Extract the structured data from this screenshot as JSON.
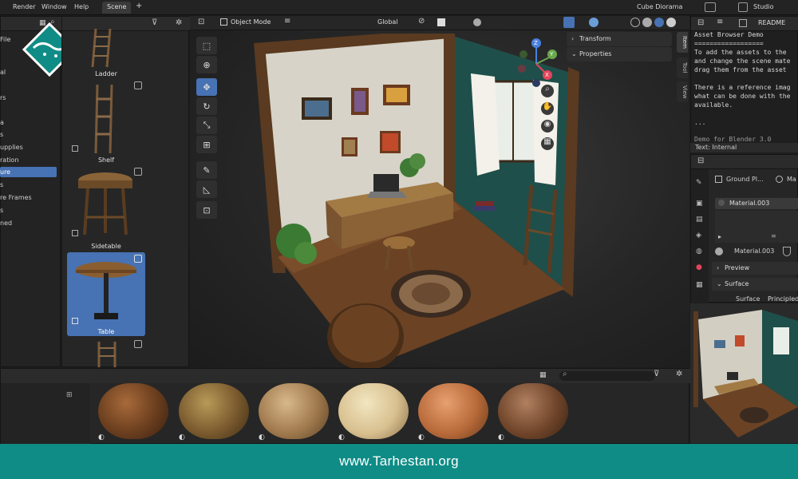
{
  "topbar": {
    "menus": [
      "Render",
      "Window",
      "Help"
    ],
    "scene_tab": "Scene",
    "plus": "+",
    "scene_name": "Cube Diorama",
    "workspace": "Studio"
  },
  "left_panel": {
    "tree_items": [
      "File",
      "al",
      "rs",
      "a",
      "s",
      "upplies",
      "ration",
      "ure",
      "s",
      "re Frames",
      "s",
      "ned"
    ],
    "active_index": 7
  },
  "asset_panel": {
    "items": [
      {
        "label": "Ladder"
      },
      {
        "label": "Shelf"
      },
      {
        "label": "Sidetable"
      },
      {
        "label": "Table"
      }
    ],
    "selected": "Table"
  },
  "viewport": {
    "mode": "Object Mode",
    "transform_orientation": "Global",
    "sidebar_tabs": [
      "Item",
      "Tool",
      "View"
    ],
    "panels": [
      "Transform",
      "Properties"
    ],
    "gizmo_axes": {
      "z": "Z",
      "y": "Y",
      "x": "X"
    },
    "colors": {
      "x": "#e2455a",
      "y": "#6aa84f",
      "z": "#4a7fe0"
    }
  },
  "text_editor": {
    "header_label": "README",
    "lines": [
      "Asset Browser Demo",
      "==================",
      "To add the assets to the",
      "and change the scene mate",
      "drag them from the asset",
      "",
      "There is a reference imag",
      "what can be done with the",
      "available.",
      "",
      "...",
      "",
      "Demo for Blender 3.0"
    ],
    "footer": "Text: Internal"
  },
  "properties": {
    "object_name": "Ground Pl...",
    "object_material_short": "Ma",
    "material_slot": "Material.003",
    "material_name": "Material.003",
    "sections": [
      "Preview",
      "Surface"
    ],
    "surface_row": "Surface",
    "shader": "Principled"
  },
  "material_browser": {
    "count": 6
  },
  "footer": {
    "url": "www.Tarhestan.org"
  }
}
